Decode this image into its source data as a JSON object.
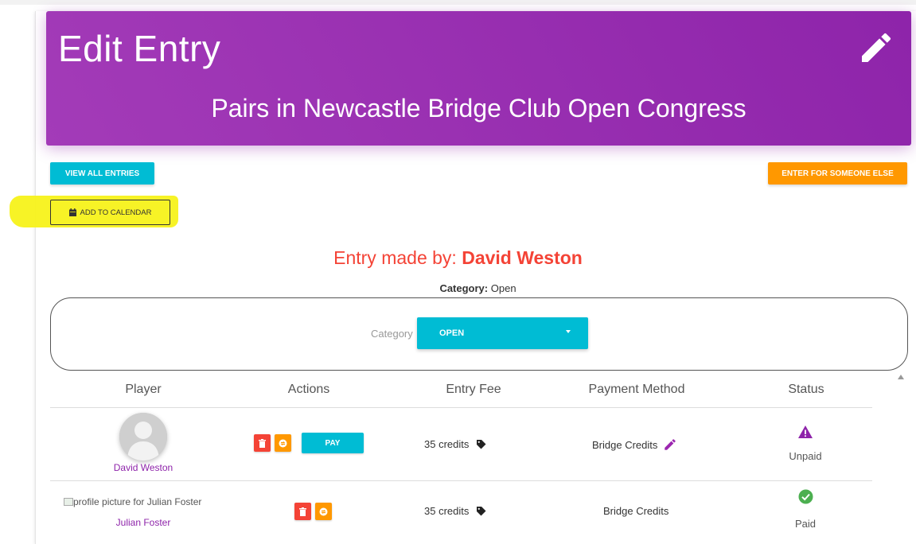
{
  "header": {
    "title": "Edit Entry",
    "subtitle": "Pairs in Newcastle Bridge Club Open Congress",
    "edit_icon": "pencil-icon"
  },
  "buttons": {
    "view_all": "VIEW ALL ENTRIES",
    "enter_else": "ENTER FOR SOMEONE ELSE",
    "add_calendar": "ADD TO CALENDAR",
    "calendar_icon": "calendar-icon"
  },
  "entry": {
    "made_by_label": "Entry made by:",
    "made_by_name": "David Weston",
    "category_label": "Category:",
    "category_value": "Open"
  },
  "category_select": {
    "label": "Category",
    "value": "OPEN"
  },
  "table": {
    "headers": [
      "Player",
      "Actions",
      "Entry Fee",
      "Payment Method",
      "Status"
    ],
    "rows": [
      {
        "player": "David Weston",
        "pay_label": "PAY",
        "fee": "35 credits",
        "payment": "Bridge Credits",
        "status": "Unpaid",
        "status_icon": "warning-icon"
      },
      {
        "player": "Julian Foster",
        "image_alt": "profile picture for Julian Foster",
        "fee": "35 credits",
        "payment": "Bridge Credits",
        "status": "Paid",
        "status_icon": "check-circle-icon"
      }
    ]
  },
  "colors": {
    "header_purple": "#9c27b0",
    "cyan": "#00bcd4",
    "orange": "#ff9800",
    "red": "#f44336",
    "highlight": "#f7f21a"
  }
}
